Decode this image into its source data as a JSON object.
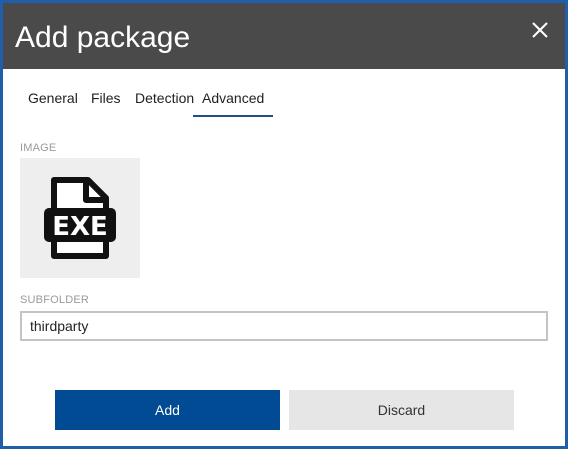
{
  "dialog": {
    "title": "Add package",
    "close_icon": "close-icon"
  },
  "tabs": [
    {
      "label": "General",
      "active": false
    },
    {
      "label": "Files",
      "active": false
    },
    {
      "label": "Detection",
      "active": false
    },
    {
      "label": "Advanced",
      "active": true
    }
  ],
  "image": {
    "label": "IMAGE",
    "icon": "exe-file-icon",
    "icon_text": "EXE"
  },
  "subfolder": {
    "label": "SUBFOLDER",
    "value": "thirdparty"
  },
  "buttons": {
    "add_label": "Add",
    "discard_label": "Discard"
  },
  "colors": {
    "border": "#1f5ea8",
    "titlebar": "#4a4a4a",
    "primary": "#004b93",
    "secondary": "#e6e6e6",
    "tab_underline": "#1f4f8c"
  }
}
